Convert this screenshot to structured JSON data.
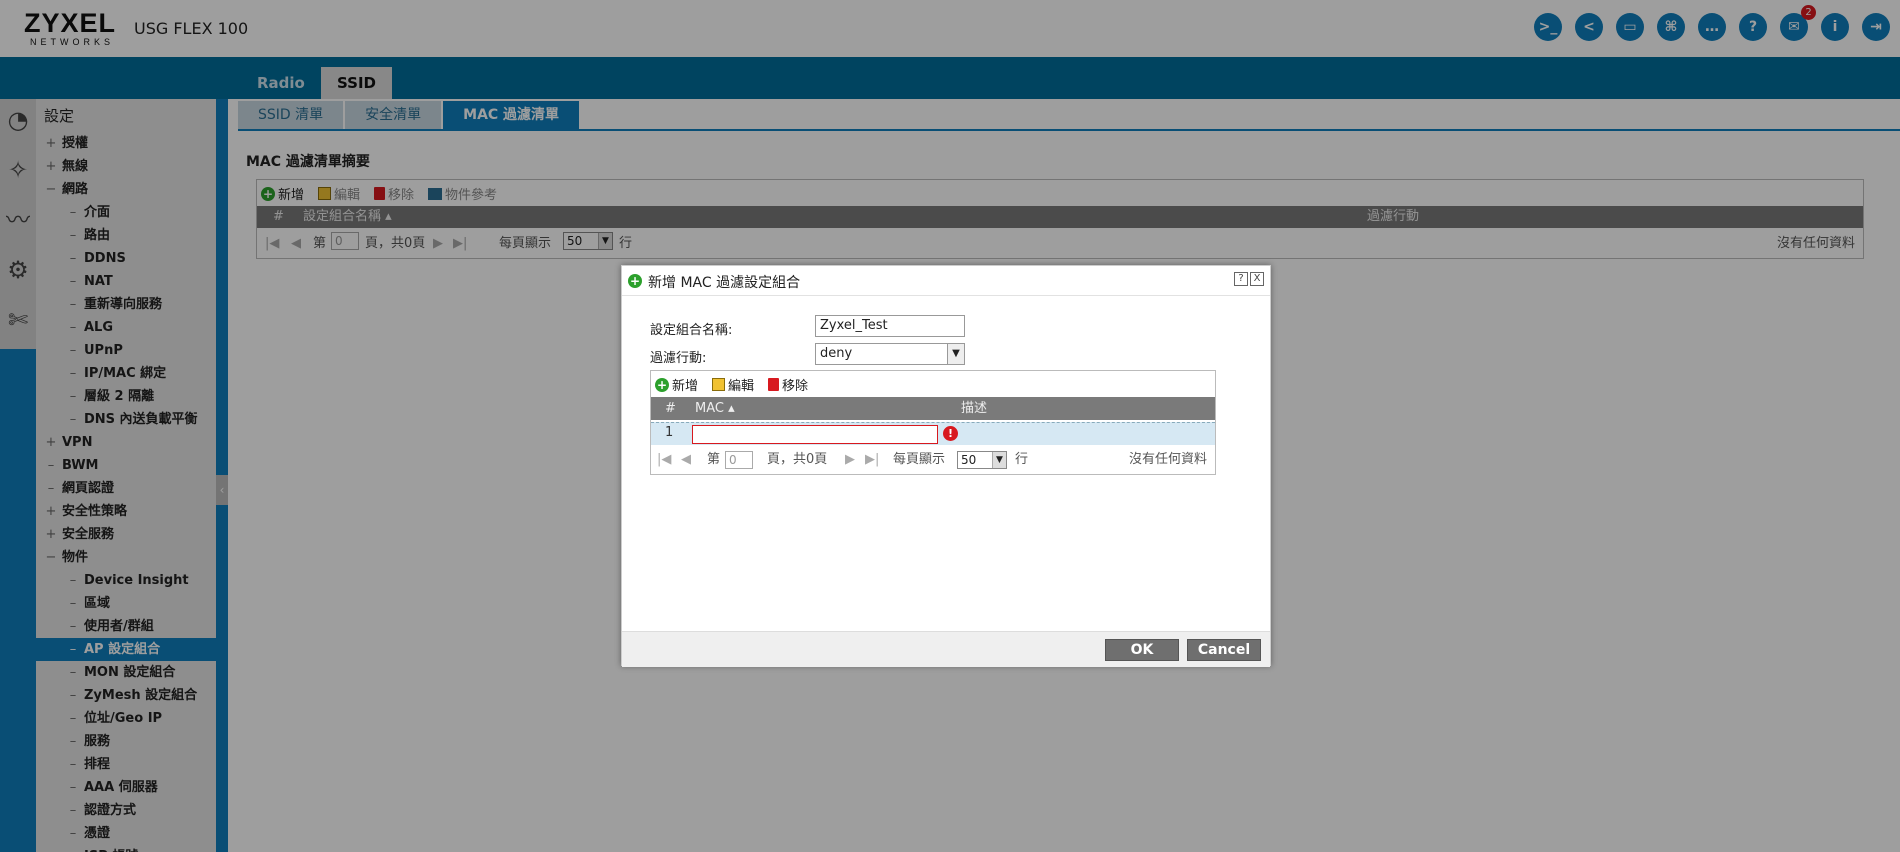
{
  "header": {
    "brand_line1": "ZYXEL",
    "brand_line2": "NETWORKS",
    "model": "USG FLEX 100",
    "icons": [
      "console-icon",
      "cli-icon",
      "window-icon",
      "topology-icon",
      "chat-icon",
      "help-icon",
      "notification-icon",
      "info-icon",
      "logout-icon"
    ],
    "notification_count": "2"
  },
  "top_tabs": [
    {
      "label": "Radio"
    },
    {
      "label": "SSID"
    }
  ],
  "sidebar": {
    "title": "設定",
    "items": [
      {
        "sym": "+",
        "label": "授權",
        "level": 1
      },
      {
        "sym": "+",
        "label": "無線",
        "level": 1
      },
      {
        "sym": "−",
        "label": "網路",
        "level": 1
      },
      {
        "sym": "–",
        "label": "介面",
        "level": 2
      },
      {
        "sym": "–",
        "label": "路由",
        "level": 2
      },
      {
        "sym": "–",
        "label": "DDNS",
        "level": 2
      },
      {
        "sym": "–",
        "label": "NAT",
        "level": 2
      },
      {
        "sym": "–",
        "label": "重新導向服務",
        "level": 2
      },
      {
        "sym": "–",
        "label": "ALG",
        "level": 2
      },
      {
        "sym": "–",
        "label": "UPnP",
        "level": 2
      },
      {
        "sym": "–",
        "label": "IP/MAC 綁定",
        "level": 2
      },
      {
        "sym": "–",
        "label": "層級 2 隔離",
        "level": 2
      },
      {
        "sym": "–",
        "label": "DNS 內送負載平衡",
        "level": 2
      },
      {
        "sym": "+",
        "label": "VPN",
        "level": 1
      },
      {
        "sym": "–",
        "label": "BWM",
        "level": 1
      },
      {
        "sym": "–",
        "label": "網頁認證",
        "level": 1
      },
      {
        "sym": "+",
        "label": "安全性策略",
        "level": 1
      },
      {
        "sym": "+",
        "label": "安全服務",
        "level": 1
      },
      {
        "sym": "−",
        "label": "物件",
        "level": 1
      },
      {
        "sym": "–",
        "label": "Device Insight",
        "level": 2
      },
      {
        "sym": "–",
        "label": "區域",
        "level": 2
      },
      {
        "sym": "–",
        "label": "使用者/群組",
        "level": 2
      },
      {
        "sym": "–",
        "label": "AP 設定組合",
        "level": 2,
        "selected": true
      },
      {
        "sym": "–",
        "label": "MON 設定組合",
        "level": 2
      },
      {
        "sym": "–",
        "label": "ZyMesh 設定組合",
        "level": 2
      },
      {
        "sym": "–",
        "label": "位址/Geo IP",
        "level": 2
      },
      {
        "sym": "–",
        "label": "服務",
        "level": 2
      },
      {
        "sym": "–",
        "label": "排程",
        "level": 2
      },
      {
        "sym": "–",
        "label": "AAA 伺服器",
        "level": 2
      },
      {
        "sym": "–",
        "label": "認證方式",
        "level": 2
      },
      {
        "sym": "–",
        "label": "憑證",
        "level": 2
      },
      {
        "sym": "–",
        "label": "ISP 帳號",
        "level": 2
      }
    ]
  },
  "sub_tabs": [
    {
      "label": "SSID 清單"
    },
    {
      "label": "安全清單"
    },
    {
      "label": "MAC 過濾清單"
    }
  ],
  "summary": {
    "title": "MAC 過濾清單摘要",
    "toolbar": {
      "add": "新增",
      "edit": "編輯",
      "remove": "移除",
      "reference": "物件參考"
    },
    "columns": {
      "num": "#",
      "name": "設定組合名稱",
      "action": "過濾行動"
    },
    "pager": {
      "page_prefix": "第",
      "page_value": "0",
      "page_suffix": "頁，共0頁",
      "per_page": "每頁顯示",
      "per_page_value": "50",
      "rows_unit": "行",
      "empty": "沒有任何資料"
    }
  },
  "modal": {
    "title": "新增 MAC 過濾設定組合",
    "help": "?",
    "close": "X",
    "name_label": "設定組合名稱:",
    "name_value": "Zyxel_Test",
    "action_label": "過濾行動:",
    "action_value": "deny",
    "toolbar": {
      "add": "新增",
      "edit": "編輯",
      "remove": "移除"
    },
    "columns": {
      "num": "#",
      "mac": "MAC",
      "desc": "描述"
    },
    "row": {
      "num": "1",
      "mac_value": ""
    },
    "pager": {
      "page_prefix": "第",
      "page_value": "0",
      "page_suffix": "頁，共0頁",
      "per_page": "每頁顯示",
      "per_page_value": "50",
      "rows_unit": "行",
      "empty": "沒有任何資料"
    },
    "ok": "OK",
    "cancel": "Cancel"
  }
}
